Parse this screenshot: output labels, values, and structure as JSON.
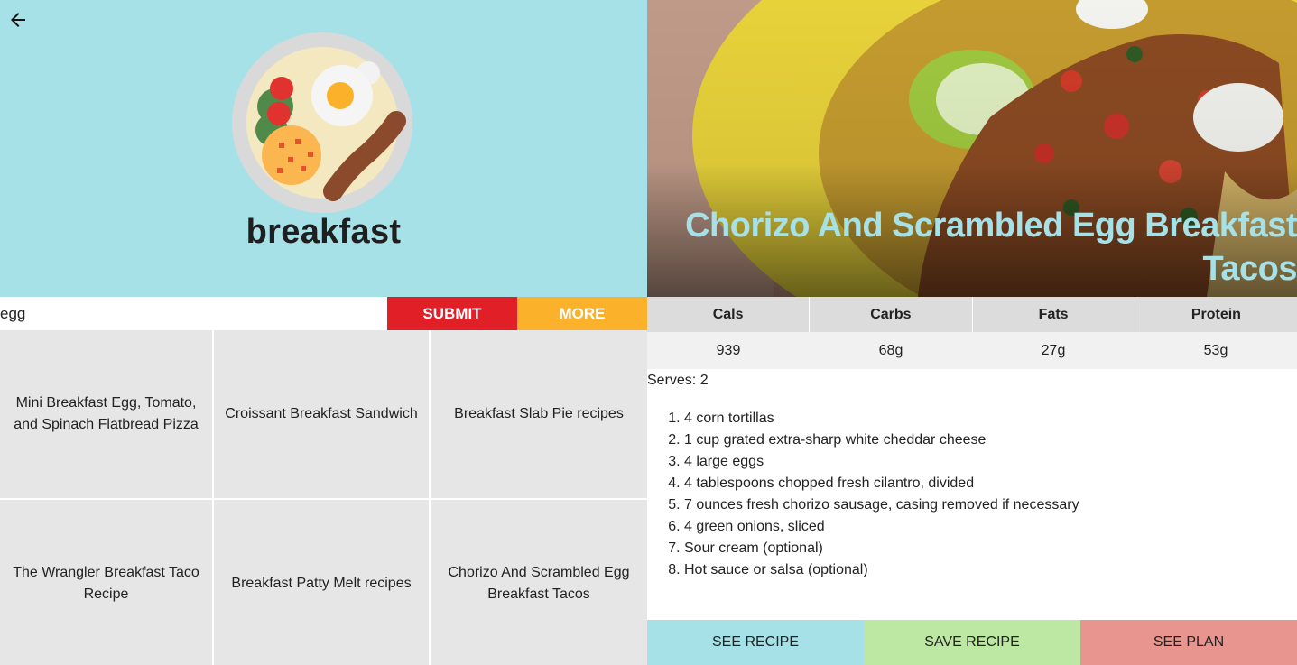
{
  "category": {
    "title": "breakfast"
  },
  "search": {
    "value": "egg",
    "submit_label": "SUBMIT",
    "more_label": "MORE"
  },
  "results": [
    "Mini Breakfast Egg, Tomato, and Spinach Flatbread Pizza",
    "Croissant Breakfast Sandwich",
    "Breakfast Slab Pie recipes",
    "The Wrangler Breakfast Taco Recipe",
    "Breakfast Patty Melt recipes",
    "Chorizo And Scrambled Egg Breakfast Tacos"
  ],
  "recipe": {
    "title": "Chorizo And Scrambled Egg Breakfast Tacos",
    "nutrition_headers": [
      "Cals",
      "Carbs",
      "Fats",
      "Protein"
    ],
    "nutrition_values": [
      "939",
      "68g",
      "27g",
      "53g"
    ],
    "serves": "Serves: 2",
    "ingredients": [
      "4 corn tortillas",
      "1 cup grated extra-sharp white cheddar cheese",
      "4 large eggs",
      "4 tablespoons chopped fresh cilantro, divided",
      "7 ounces fresh chorizo sausage, casing removed if necessary",
      "4 green onions, sliced",
      "Sour cream (optional)",
      "Hot sauce or salsa (optional)"
    ]
  },
  "actions": {
    "see_recipe": "SEE RECIPE",
    "save_recipe": "SAVE RECIPE",
    "see_plan": "SEE PLAN"
  },
  "colors": {
    "hero_bg": "#a6e1e8",
    "submit": "#e01f26",
    "more": "#fbb22a",
    "see_recipe": "#a6e1e8",
    "save_recipe": "#bde8a3",
    "see_plan": "#e8958f"
  },
  "icons": {
    "back": "arrow-left-icon",
    "category": "breakfast-plate-icon"
  }
}
